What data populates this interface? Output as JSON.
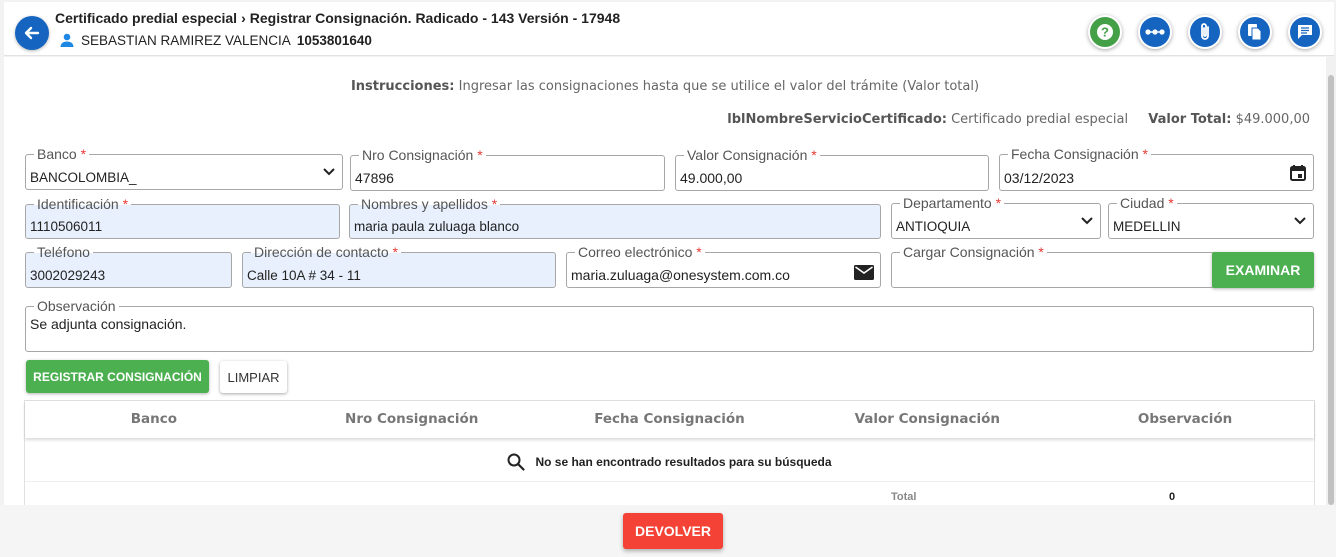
{
  "header": {
    "breadcrumb_1": "Certificado predial especial",
    "breadcrumb_2": "Registrar Consignación. Radicado - 143 Versión - 17948",
    "user_name": "SEBASTIAN RAMIREZ VALENCIA",
    "user_id": "1053801640",
    "icons": [
      "arrow-left-icon",
      "question-icon",
      "more-icon",
      "paperclip-icon",
      "copy-icon",
      "comment-icon"
    ]
  },
  "info": {
    "instr_label": "Instrucciones:",
    "instr_text": "Ingresar las consignaciones hasta que se utilice el valor del trámite (Valor total)",
    "svc_label": "lblNombreServicioCertificado:",
    "svc_value": "Certificado predial especial",
    "total_label": "Valor Total:",
    "total_value": "$49.000,00"
  },
  "form": {
    "required_mark": "*",
    "banco": {
      "label": "Banco",
      "value": "BANCOLOMBIA_"
    },
    "nro": {
      "label": "Nro Consignación",
      "value": "47896"
    },
    "valor": {
      "label": "Valor Consignación",
      "value": "49.000,00"
    },
    "fecha": {
      "label": "Fecha Consignación",
      "value": "03/12/2023"
    },
    "identificacion": {
      "label": "Identificación",
      "value": "1110506011"
    },
    "nombres": {
      "label": "Nombres y apellidos",
      "value": "maria paula zuluaga blanco"
    },
    "departamento": {
      "label": "Departamento",
      "value": "ANTIOQUIA"
    },
    "ciudad": {
      "label": "Ciudad",
      "value": "MEDELLIN"
    },
    "telefono": {
      "label": "Teléfono",
      "value": "3002029243"
    },
    "direccion": {
      "label": "Dirección de contacto",
      "value": "Calle 10A # 34 - 11"
    },
    "correo": {
      "label": "Correo electrónico",
      "value": "maria.zuluaga@onesystem.com.co"
    },
    "cargar": {
      "label": "Cargar Consignación",
      "value": ""
    },
    "observacion": {
      "label": "Observación",
      "value": "Se adjunta consignación."
    },
    "examinar_label": "EXAMINAR",
    "registrar_label": "REGISTRAR CONSIGNACIÓN",
    "limpiar_label": "LIMPIAR"
  },
  "table": {
    "columns": [
      "Banco",
      "Nro Consignación",
      "Fecha Consignación",
      "Valor Consignación",
      "Observación"
    ],
    "empty_message": "No se han encontrado resultados para su búsqueda",
    "total_label": "Total",
    "total_value": "0"
  },
  "footer": {
    "devolver_label": "DEVOLVER"
  },
  "colors": {
    "primary": "#1565c0",
    "success": "#4caf50",
    "danger": "#f44336",
    "help": "#43a047"
  }
}
